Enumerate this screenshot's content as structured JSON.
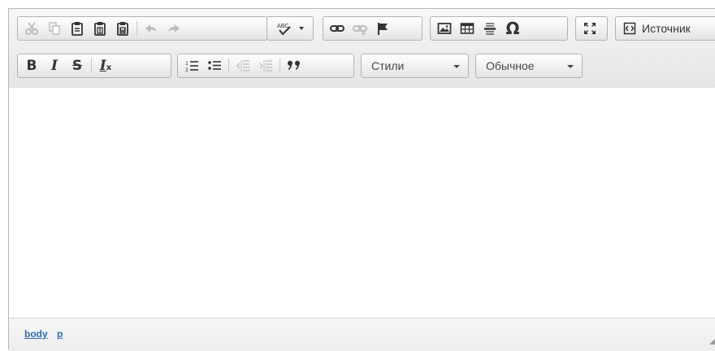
{
  "toolbar": {
    "source_label": "Источник",
    "styles_combo": "Стили",
    "format_combo": "Обычное",
    "spellcheck_label": "ABC",
    "bold_glyph": "B",
    "italic_glyph": "I",
    "strike_glyph": "S",
    "removeformat_glyph": "I",
    "removeformat_sub": "x",
    "blockquote_glyph": "❞❞",
    "special_char_glyph": "Ω",
    "numbered_list_glyph": "1≡",
    "bulleted_list_glyph": "•≡"
  },
  "statusbar": {
    "path": [
      "body",
      "p"
    ]
  },
  "colors": {
    "link": "#2c6cb5",
    "icon": "#333333",
    "disabled_icon": "#bdbdbd"
  }
}
